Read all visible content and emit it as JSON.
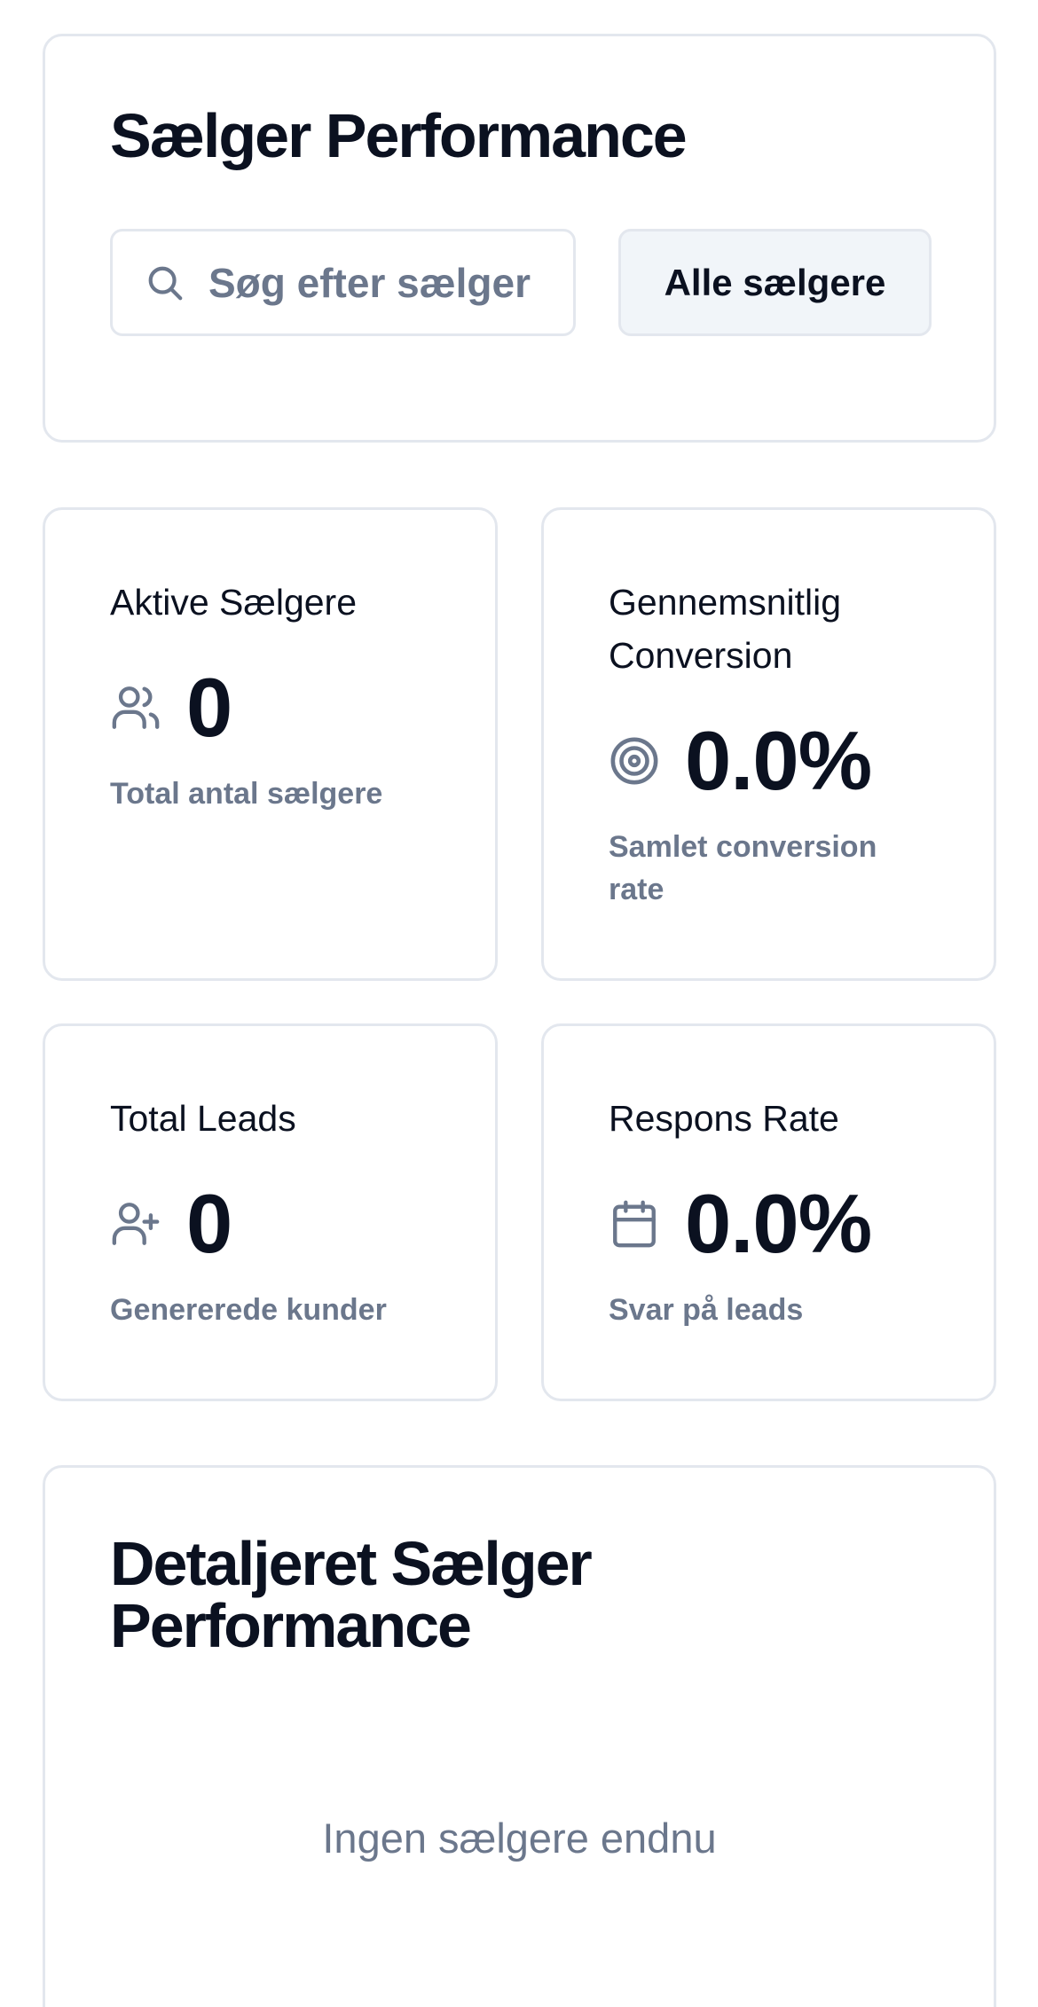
{
  "header": {
    "title": "Sælger Performance",
    "search_placeholder": "Søg efter sælger",
    "search_value": "",
    "filter_label": "Alle sælgere"
  },
  "stats": [
    {
      "label": "Aktive Sælgere",
      "value": "0",
      "sub": "Total antal sælgere",
      "icon": "users-icon"
    },
    {
      "label": "Gennemsnitlig Conversion",
      "value": "0.0%",
      "sub": "Samlet conversion rate",
      "icon": "target-icon"
    },
    {
      "label": "Total Leads",
      "value": "0",
      "sub": "Genererede kunder",
      "icon": "user-plus-icon"
    },
    {
      "label": "Respons Rate",
      "value": "0.0%",
      "sub": "Svar på leads",
      "icon": "calendar-icon"
    }
  ],
  "detail": {
    "title": "Detaljeret Sælger Performance",
    "empty_text": "Ingen sælgere endnu"
  },
  "colors": {
    "text": "#0b1120",
    "muted": "#6b778c",
    "border": "#e3e7ee",
    "button_bg": "#f1f5f9"
  }
}
